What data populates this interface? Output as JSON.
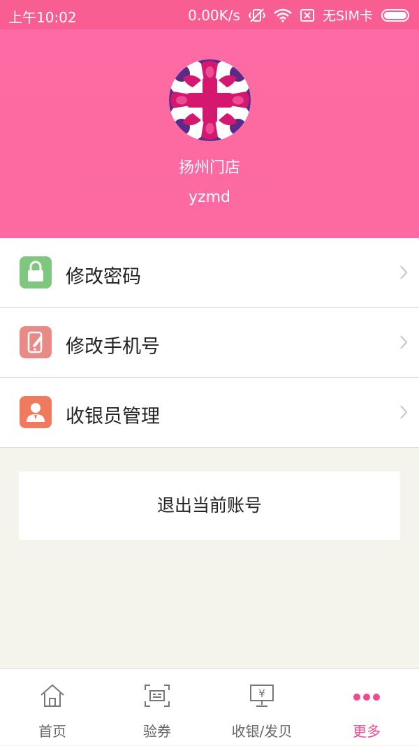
{
  "status_bar": {
    "time": "上午10:02",
    "speed": "0.00K/s",
    "sim": "无SIM卡",
    "battery_level": 1.0
  },
  "profile": {
    "store_name": "扬州门店",
    "store_code": "yzmd"
  },
  "menu": {
    "items": [
      {
        "label": "修改密码",
        "icon": "lock-icon",
        "color": "#7fc77e"
      },
      {
        "label": "修改手机号",
        "icon": "phone-edit-icon",
        "color": "#ea8a86"
      },
      {
        "label": "收银员管理",
        "icon": "person-icon",
        "color": "#f07a5e"
      }
    ]
  },
  "logout": {
    "label": "退出当前账号"
  },
  "tabbar": {
    "tabs": [
      {
        "label": "首页",
        "icon": "home-icon"
      },
      {
        "label": "验券",
        "icon": "scan-ticket-icon"
      },
      {
        "label": "收银/发贝",
        "icon": "cashier-monitor-icon"
      },
      {
        "label": "更多",
        "icon": "more-dots-icon",
        "active": true
      }
    ]
  },
  "colors": {
    "accent": "#f0498c",
    "header_bg": "#fe6aa3",
    "status_bg": "#f85e92"
  }
}
